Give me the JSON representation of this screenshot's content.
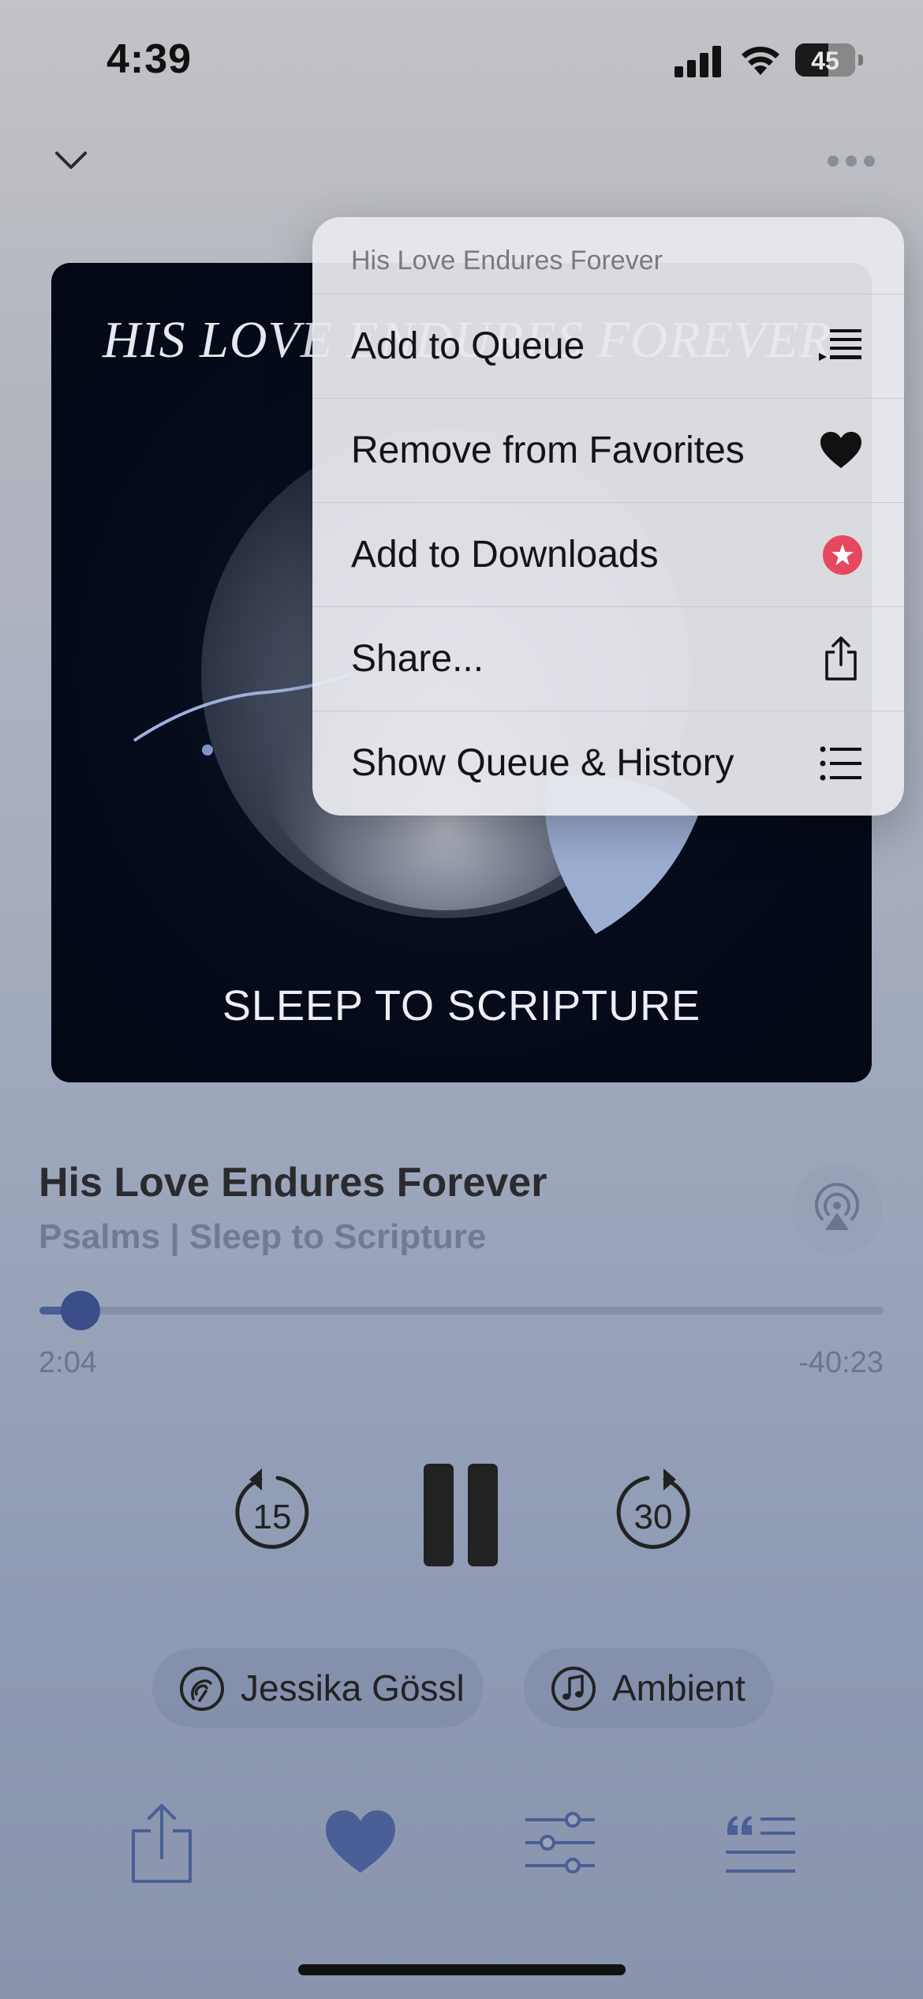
{
  "status_bar": {
    "time": "4:39",
    "battery": "45"
  },
  "nav": {
    "collapse_icon": "chevron-down-icon",
    "more_icon": "ellipsis-icon"
  },
  "artwork": {
    "title_text": "HIS LOVE ENDURES FOREVER",
    "subtitle_text": "SLEEP TO SCRIPTURE"
  },
  "menu": {
    "header": "His Love Endures Forever",
    "items": [
      {
        "label": "Add to Queue",
        "icon": "add-to-queue-icon"
      },
      {
        "label": "Remove from Favorites",
        "icon": "heart-filled-icon"
      },
      {
        "label": "Add to Downloads",
        "icon": "star-badge-icon",
        "icon_color": "#e5485f"
      },
      {
        "label": "Share...",
        "icon": "share-icon"
      },
      {
        "label": "Show Queue & History",
        "icon": "list-icon"
      }
    ]
  },
  "track": {
    "title": "His Love Endures Forever",
    "subtitle": "Psalms | Sleep to Scripture",
    "elapsed": "2:04",
    "remaining": "-40:23",
    "progress_fraction": 0.049
  },
  "controls": {
    "rewind_seconds": "15",
    "forward_seconds": "30",
    "state": "playing"
  },
  "chips": {
    "voice": {
      "label": "Jessika Gössl",
      "icon": "voice-icon"
    },
    "music": {
      "label": "Ambient",
      "icon": "music-note-icon"
    }
  },
  "toolbar": {
    "share_icon": "share-icon",
    "favorite_icon": "heart-filled-icon",
    "settings_icon": "sliders-icon",
    "transcript_icon": "quote-icon"
  },
  "colors": {
    "accent": "#3a4f88",
    "download_badge": "#e5485f",
    "artwork_bg": "#050b1a"
  }
}
